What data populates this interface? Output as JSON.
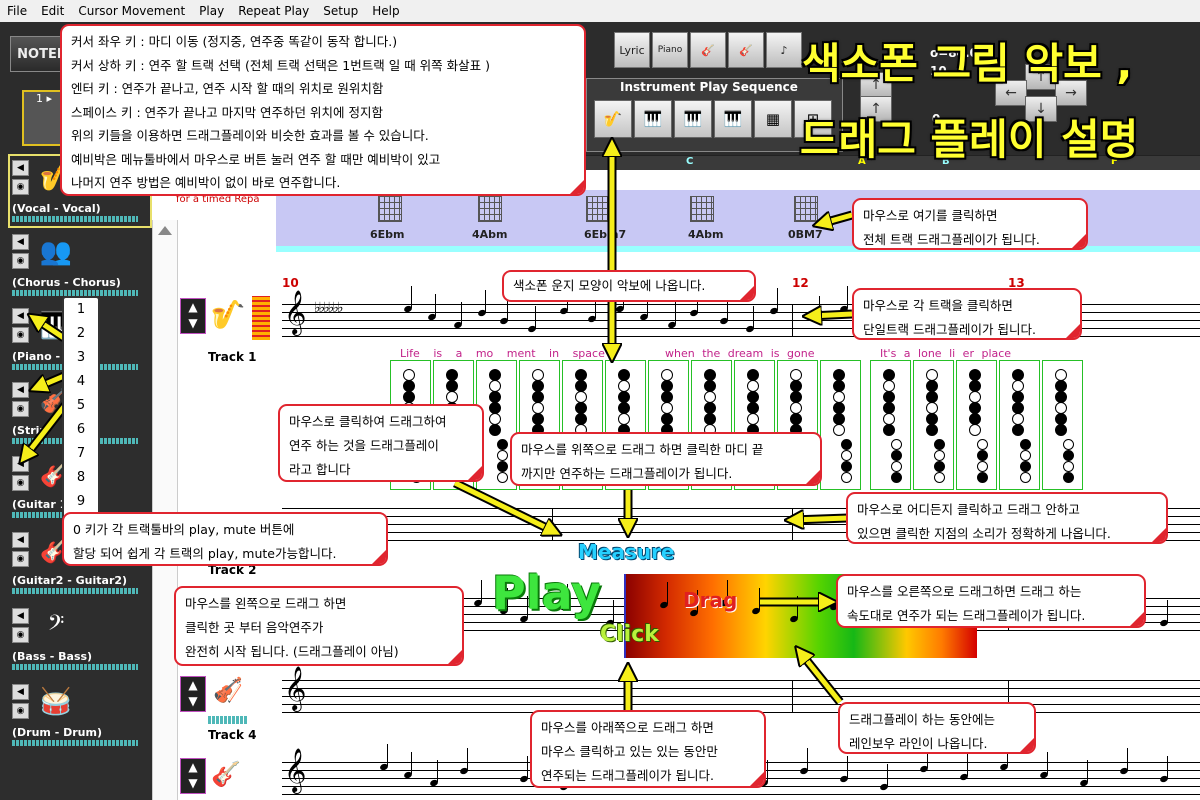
{
  "menu": [
    "File",
    "Edit",
    "Cursor Movement",
    "Play",
    "Repeat Play",
    "Setup",
    "Help"
  ],
  "toolbar": {
    "logo": "NOTER",
    "lyric_label": "Lyric",
    "piano_label": "Piano",
    "sequence_title": "Instrument Play Sequence",
    "tempo": "o=84.0",
    "tempo_sub": "10",
    "zero": "0"
  },
  "ruler_letters": [
    "C",
    "A",
    "B",
    "F"
  ],
  "title": {
    "line1": "색소폰 그림 악보 ,",
    "line2": "드래그 플레이 설명"
  },
  "tracks": [
    {
      "name": "(Vocal - Vocal)",
      "icon": "saxophone-icon"
    },
    {
      "name": "(Chorus - Chorus)",
      "icon": "chorus-icon"
    },
    {
      "name": "(Piano -",
      "icon": "piano-icon"
    },
    {
      "name": "(Strin",
      "icon": "strings-icon"
    },
    {
      "name": "(Guitar 1",
      "icon": "guitar-icon"
    },
    {
      "name": "(Guitar2 - Guitar2)",
      "icon": "guitar2-icon"
    },
    {
      "name": "(Bass - Bass)",
      "icon": "bass-clef-icon"
    },
    {
      "name": "(Drum - Drum)",
      "icon": "drum-icon"
    }
  ],
  "score": {
    "chord_header": "for a timed Repa",
    "chords": [
      "6Ebm",
      "4Abm",
      "6Ebm7",
      "4Abm",
      "0BM7"
    ],
    "measures": [
      "10",
      "12",
      "13"
    ],
    "track1_label": "Track 1",
    "track2_label": "Track 2",
    "track4_label": "Track 4",
    "lyrics": [
      "Life is a mo ment in space",
      "when the dream is gone",
      "It's a lone li er place"
    ]
  },
  "numbers": [
    "1",
    "2",
    "3",
    "4",
    "5",
    "6",
    "7",
    "8",
    "9"
  ],
  "callouts": {
    "keys": [
      "커서 좌우 키 : 마디 이동 (정지중, 연주중 똑같이 동작 합니다.)",
      "커서 상하 키 : 연주 할 트랙 선택 (전체 트랙 선택은 1번트랙 일 때 위쪽 화살표 )",
      "엔터 키 : 연주가 끝나고, 연주 시작 할 때의 위치로 원위치함",
      "스페이스 키 : 연주가 끝나고 마지막 연주하던 위치에 정지함",
      "위의 키들을 이용하면 드래그플레이와 비슷한 효과를 볼 수 있습니다.",
      "예비박은 메뉴툴바에서 마우스로 버튼 눌러 연주 할 때만 예비박이 있고",
      "나머지 연주 방법은 예비박이 없이 바로 연주합니다."
    ],
    "all_tracks": [
      "마우스로 여기를 클릭하면",
      "전체 트랙 드래그플레이가 됩니다."
    ],
    "sax_shape": [
      "색소폰 운지 모양이 악보에 나옵니다."
    ],
    "single_track": [
      "마우스로 각 트랙을 클릭하면",
      "단일트랙 드래그플레이가 됩니다."
    ],
    "drag_play_def": [
      "마우스로 클릭하여 드래그하여",
      "연주 하는 것을 드래그플레이",
      "라고 합니다"
    ],
    "drag_up": [
      "마우스를 위쪽으로 드래그 하면 클릭한 마디 끝",
      "까지만 연주하는 드래그플레이가 됩니다."
    ],
    "anywhere": [
      "마우스로 어디든지 클릭하고 드래그 안하고",
      "있으면 클릭한 지점의 소리가 정확하게 나옵니다."
    ],
    "zero_key": [
      "0 키가 각 트랙툴바의 play, mute 버튼에",
      "할당 되어 쉽게 각 트랙의 play, mute가능합니다."
    ],
    "drag_left": [
      "마우스를 왼쪽으로 드래그 하면",
      "클릭한 곳 부터 음악연주가",
      "완전히 시작 됩니다. (드래그플레이 아님)"
    ],
    "drag_right": [
      "마우스를 오른쪽으로 드래그하면 드래그 하는",
      "속도대로 연주가 되는 드래그플레이가 됩니다."
    ],
    "rainbow": [
      "드래그플레이 하는 동안에는",
      "레인보우 라인이 나옵니다."
    ],
    "drag_down": [
      "마우스를 아래쪽으로 드래그 하면",
      "마우스 클릭하고 있는  있는 동안만",
      "연주되는 드래그플레이가 됩니다."
    ]
  },
  "labels": {
    "measure": "Measure",
    "play": "Play",
    "drag": "Drag",
    "click": "Click"
  },
  "colors": {
    "callout_border": "#e0252f",
    "title_yellow": "#ffff30",
    "arrow_yellow": "#f5ee1a"
  }
}
